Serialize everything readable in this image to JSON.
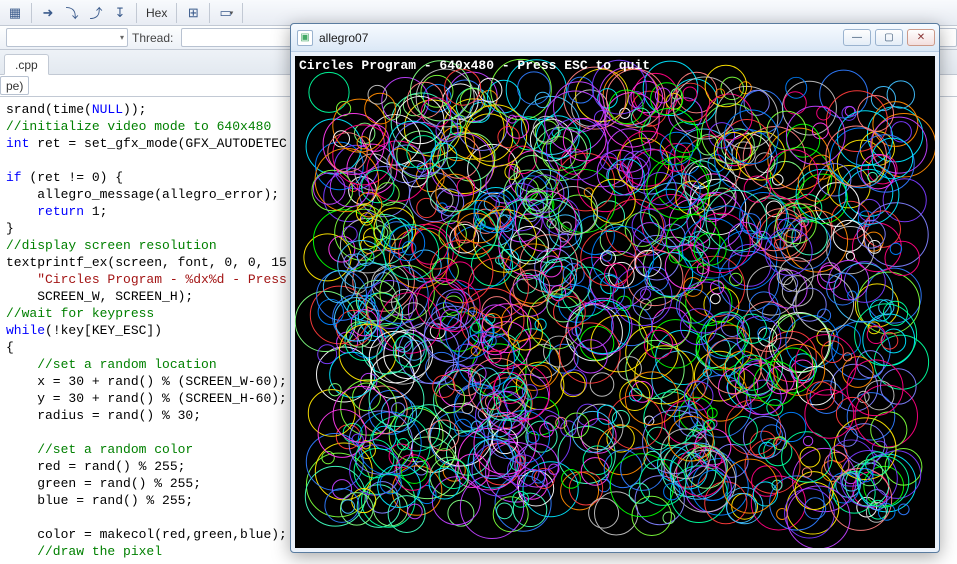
{
  "toolbar": {
    "hex_label": "Hex"
  },
  "threadbar": {
    "label": "Thread:"
  },
  "tab": {
    "name": ".cpp"
  },
  "scope": {
    "name": "pe)"
  },
  "code": {
    "l01a": "srand(time(",
    "l01b": "NULL",
    "l01c": "));",
    "l02": "//initialize video mode to 640x480",
    "l03a": "int",
    "l03b": " ret = set_gfx_mode(GFX_AUTODETEC",
    "l04": "",
    "l05a": "if",
    "l05b": " (ret != 0) {",
    "l06": "    allegro_message(allegro_error);",
    "l07a": "    ",
    "l07b": "return",
    "l07c": " 1;",
    "l08": "}",
    "l09": "//display screen resolution",
    "l10": "textprintf_ex(screen, font, 0, 0, 15",
    "l11": "    \"Circles Program - %dx%d - Press",
    "l12": "    SCREEN_W, SCREEN_H);",
    "l13": "//wait for keypress",
    "l14a": "while",
    "l14b": "(!key[KEY_ESC])",
    "l15": "{",
    "l16": "    //set a random location",
    "l17": "    x = 30 + rand() % (SCREEN_W-60);",
    "l18": "    y = 30 + rand() % (SCREEN_H-60);",
    "l19": "    radius = rand() % 30;",
    "l20": "",
    "l21": "    //set a random color",
    "l22": "    red = rand() % 255;",
    "l23": "    green = rand() % 255;",
    "l24": "    blue = rand() % 255;",
    "l25": "",
    "l26": "    color = makecol(red,green,blue);",
    "l27": "    //draw the pixel"
  },
  "appwin": {
    "title": "allegro07",
    "banner": "Circles Program - 640x480 - Press ESC to quit"
  }
}
